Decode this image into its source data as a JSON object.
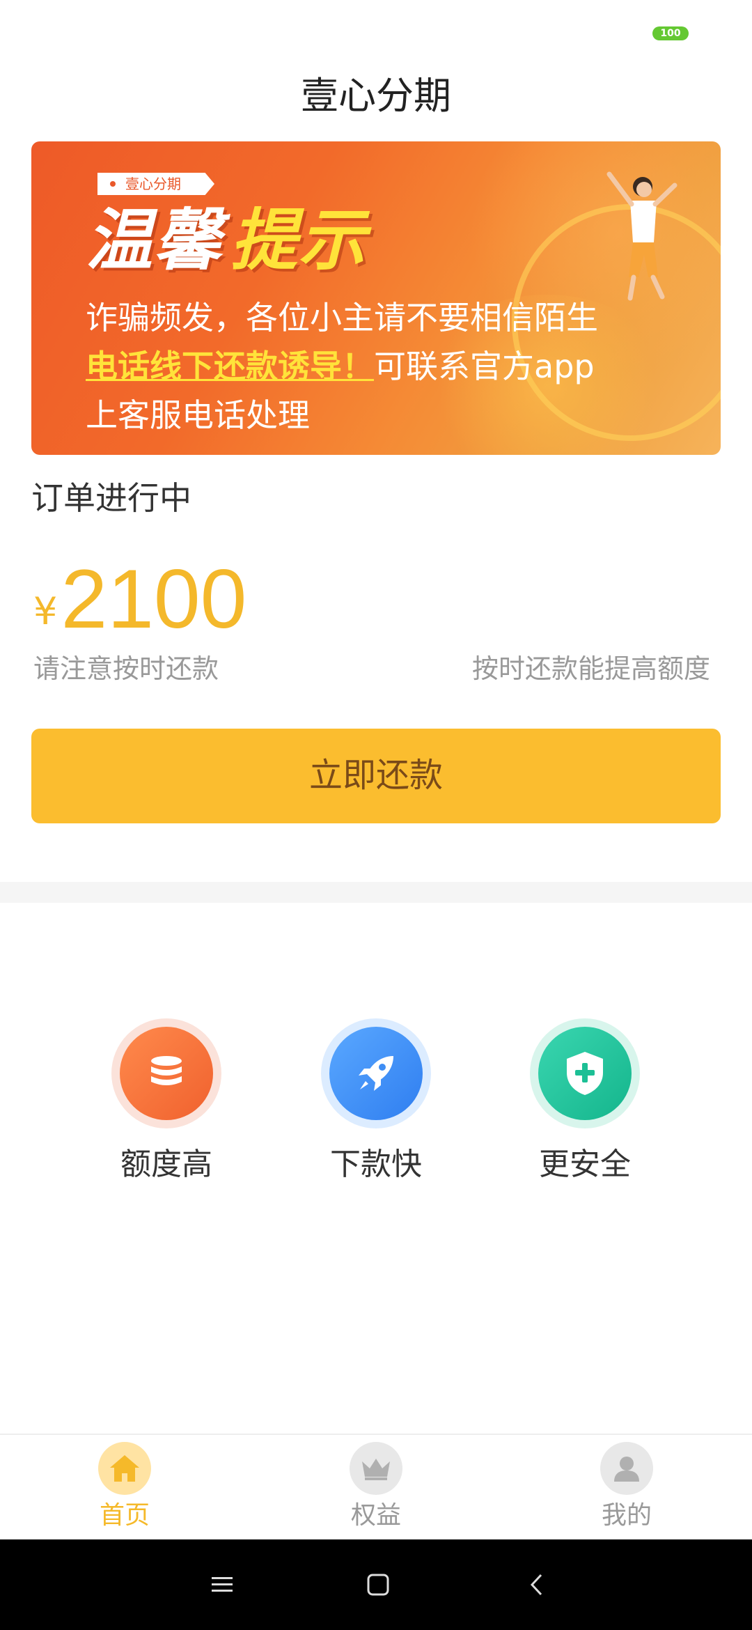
{
  "status_bar": {
    "battery": "100"
  },
  "header": {
    "title": "壹心分期"
  },
  "banner": {
    "badge": "壹心分期",
    "headline_white": "温馨",
    "headline_yellow": "提示",
    "line1": "诈骗频发，各位小主请不要相信陌生",
    "line2_highlight": "电话线下还款诱导！",
    "line2_rest": "可联系官方app",
    "line3": "上客服电话处理"
  },
  "order": {
    "status": "订单进行中",
    "currency": "¥",
    "amount": "2100",
    "note_left": "请注意按时还款",
    "note_right": "按时还款能提高额度",
    "repay_button": "立即还款"
  },
  "features": [
    {
      "label": "额度高",
      "icon": "database-coins-icon"
    },
    {
      "label": "下款快",
      "icon": "rocket-icon"
    },
    {
      "label": "更安全",
      "icon": "shield-plus-icon"
    }
  ],
  "tabs": [
    {
      "label": "首页",
      "icon": "home-icon",
      "active": true
    },
    {
      "label": "权益",
      "icon": "crown-icon",
      "active": false
    },
    {
      "label": "我的",
      "icon": "user-icon",
      "active": false
    }
  ],
  "colors": {
    "accent": "#fbbd2f",
    "amount": "#f4b82b",
    "banner": "#ee5a28"
  }
}
